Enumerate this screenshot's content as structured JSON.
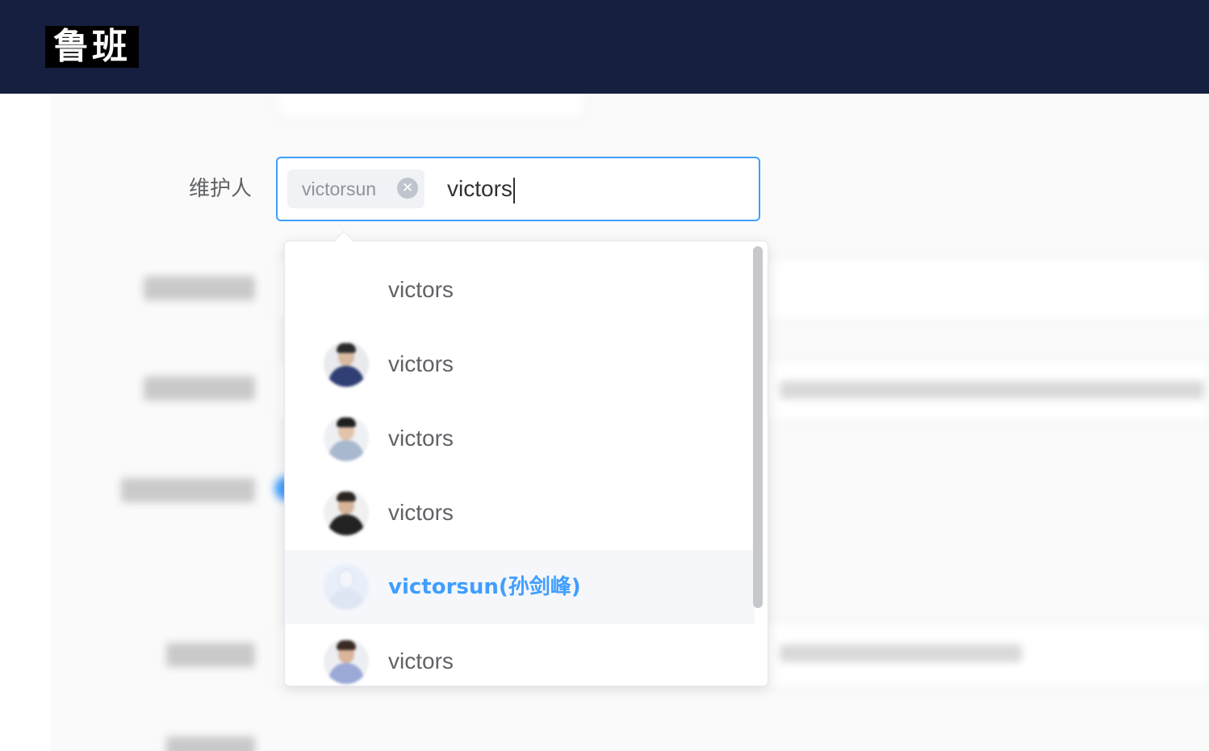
{
  "header": {
    "logo_text": "鲁班"
  },
  "form": {
    "maintainer_label": "维护人",
    "selected_tag": "victorsun",
    "search_query": "victors"
  },
  "dropdown": {
    "options": [
      {
        "prefix": "victors",
        "rest": "",
        "avatar": "none"
      },
      {
        "prefix": "victors",
        "rest": "",
        "avatar": "person-photo"
      },
      {
        "prefix": "victors",
        "rest": "",
        "avatar": "person-photo"
      },
      {
        "prefix": "victors",
        "rest": "",
        "avatar": "person-photo"
      },
      {
        "prefix": "victorsun(孙剑峰)",
        "rest": "",
        "avatar": "placeholder-avatar",
        "selected": true
      },
      {
        "prefix": "victors",
        "rest": "",
        "avatar": "person-photo"
      }
    ]
  },
  "colors": {
    "header_bg": "#161f3f",
    "accent": "#409eff",
    "tag_bg": "#f0f2f5",
    "active_option_bg": "#f5f7fa"
  }
}
